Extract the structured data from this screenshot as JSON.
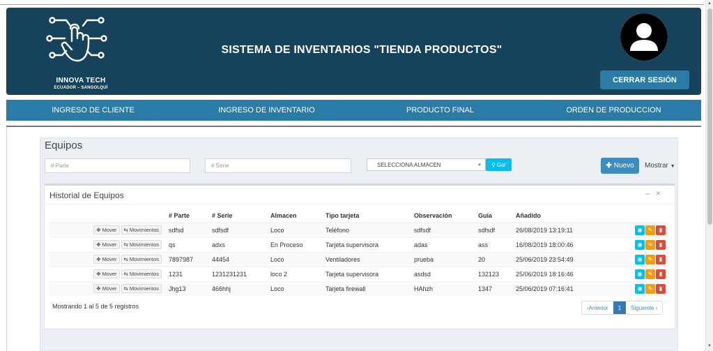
{
  "header": {
    "logo_name": "INNOVA TECH",
    "logo_sub": "ECUADOR – SANGOLQUÍ",
    "title": "SISTEMA DE INVENTARIOS \"TIENDA PRODUCTOS\"",
    "logout_label": "CERRAR SESIÓN"
  },
  "nav": [
    {
      "label": "INGRESO DE CLIENTE"
    },
    {
      "label": "INGRESO DE INVENTARIO"
    },
    {
      "label": "PRODUCTO FINAL"
    },
    {
      "label": "ORDEN DE PRODUCCION"
    }
  ],
  "page": {
    "title": "Equipos",
    "parte_placeholder": "# Parte",
    "serie_placeholder": "# Serie",
    "almacen_selected": "SELECCIONA ALMACEN",
    "go_label": "Go!",
    "nuevo_label": "Nuevo",
    "mostrar_label": "Mostrar"
  },
  "table_box": {
    "title": "Historial de Equipos",
    "columns": [
      "",
      "# Parte",
      "# Serie",
      "Almacen",
      "Tipo tarjeta",
      "Observación",
      "Guía",
      "Añadido",
      ""
    ],
    "mover_label": "Mover",
    "movimientos_label": "Movimientos",
    "rows": [
      {
        "parte": "sdfsd",
        "serie": "sdfsdf",
        "almacen": "Loco",
        "tipo": "Teléfono",
        "obs": "sdfsdf",
        "guia": "sdfsdf",
        "anadido": "26/08/2019 13:19:11"
      },
      {
        "parte": "qs",
        "serie": "adxs",
        "almacen": "En Proceso",
        "tipo": "Tarjeta supervisora",
        "obs": "adas",
        "guia": "ass",
        "anadido": "16/08/2019 18:00:46"
      },
      {
        "parte": "7897987",
        "serie": "44454",
        "almacen": "Loco",
        "tipo": "Ventiladores",
        "obs": "prueba",
        "guia": "20",
        "anadido": "25/06/2019 23:54:49"
      },
      {
        "parte": "1231",
        "serie": "1231231231",
        "almacen": "loco 2",
        "tipo": "Tarjeta supervisora",
        "obs": "asdsd",
        "guia": "132123",
        "anadido": "25/06/2019 18:16:46"
      },
      {
        "parte": "Jhg13",
        "serie": "466hhj",
        "almacen": "Loco",
        "tipo": "Tarjeta firewall",
        "obs": "HAhzh",
        "guia": "1347",
        "anadido": "25/06/2019 07:16:41"
      }
    ],
    "info": "Mostrando 1 al 5 de 5 registros",
    "prev_label": "‹Anterior",
    "page_current": "1",
    "next_label": "Siguiente ›"
  },
  "colors": {
    "header_bg": "#16425b",
    "nav_bg": "#2a7ba6",
    "primary": "#3c8dbc",
    "info": "#00c0ef",
    "warning": "#f39c12",
    "danger": "#dd4b39"
  }
}
